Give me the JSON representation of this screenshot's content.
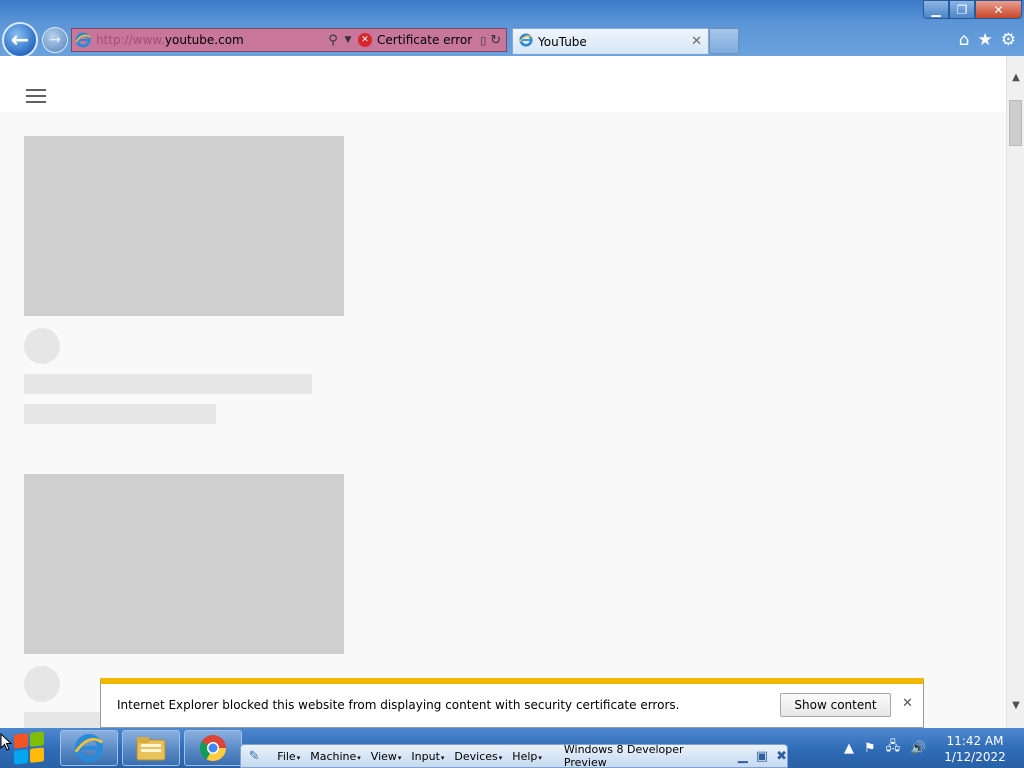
{
  "browser": {
    "address": {
      "scheme": "http://www.",
      "domain": "youtube.com"
    },
    "certificate_error": "Certificate error",
    "tab": {
      "title": "YouTube"
    },
    "window_buttons": {
      "minimize": "▁",
      "restore": "❐",
      "close": "✕"
    },
    "tool_icons": {
      "home": "⌂",
      "favorites": "★",
      "tools": "⚙"
    }
  },
  "notification": {
    "message": "Internet Explorer blocked this website from displaying content with security certificate errors.",
    "button_label": "Show content",
    "close": "✕"
  },
  "vbox": {
    "menus": [
      "File",
      "Machine",
      "View",
      "Input",
      "Devices",
      "Help"
    ],
    "title": "Windows 8 Developer Preview"
  },
  "taskbar": {
    "pinned": [
      "internet-explorer",
      "file-explorer",
      "chrome"
    ],
    "time": "11:42 AM",
    "date": "1/12/2022"
  },
  "colors": {
    "accent": "#2f6bb6",
    "cert_error_bg": "#c8779b",
    "notify_border": "#f2b800",
    "placeholder": "#cfcfcf"
  }
}
